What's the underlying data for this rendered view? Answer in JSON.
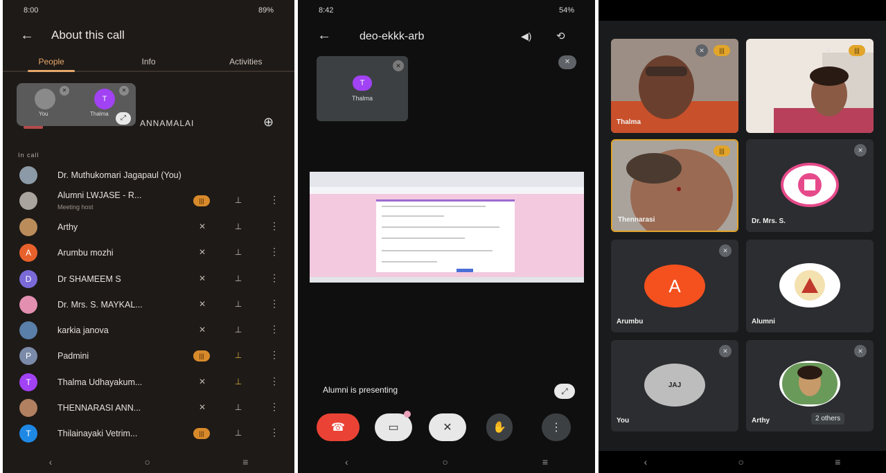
{
  "phone1": {
    "status_left": "8:00",
    "status_right": "89%",
    "title": "About this call",
    "tabs": [
      "People",
      "Info",
      "Activities"
    ],
    "pip": {
      "tile1_label": "You",
      "tile2_initial": "T",
      "tile2_label": "Thalma"
    },
    "pinned_name_suffix": "ANNAMALAI",
    "section_label": "In call",
    "participants": [
      {
        "name": "Dr. Muthukomari Jagapaul (You)",
        "initial": "",
        "color": "#8b9aa6",
        "sub": "",
        "mic": "",
        "pin": "",
        "more": ""
      },
      {
        "name": "Alumni LWJASE - R...",
        "initial": "",
        "color": "#a9a49e",
        "sub": "Meeting host",
        "mic": "talk",
        "pin": "pin",
        "more": "more"
      },
      {
        "name": "Arthy",
        "initial": "",
        "color": "#b98c5a",
        "sub": "",
        "mic": "muted",
        "pin": "pin",
        "more": "more"
      },
      {
        "name": "Arumbu mozhi",
        "initial": "A",
        "color": "#e8612c",
        "sub": "",
        "mic": "muted",
        "pin": "pin",
        "more": "more"
      },
      {
        "name": "Dr SHAMEEM S",
        "initial": "D",
        "color": "#7a6ad8",
        "sub": "",
        "mic": "muted",
        "pin": "pin",
        "more": "more"
      },
      {
        "name": "Dr. Mrs. S. MAYKAL...",
        "initial": "",
        "color": "#e28fb0",
        "sub": "",
        "mic": "muted",
        "pin": "pin",
        "more": "more"
      },
      {
        "name": "karkia janova",
        "initial": "",
        "color": "#5a7fa8",
        "sub": "",
        "mic": "muted",
        "pin": "pin",
        "more": "more"
      },
      {
        "name": "Padmini",
        "initial": "P",
        "color": "#7a8aa8",
        "sub": "",
        "mic": "talk",
        "pin": "pin-gold",
        "more": "more"
      },
      {
        "name": "Thalma Udhayakum...",
        "initial": "T",
        "color": "#a142f4",
        "sub": "",
        "mic": "muted",
        "pin": "pin-gold",
        "more": "more"
      },
      {
        "name": "THENNARASI ANN...",
        "initial": "",
        "color": "#b08060",
        "sub": "",
        "mic": "muted",
        "pin": "pin",
        "more": "more"
      },
      {
        "name": "Thilainayaki Vetrim...",
        "initial": "T",
        "color": "#1e88e5",
        "sub": "",
        "mic": "talk",
        "pin": "pin",
        "more": "more"
      }
    ]
  },
  "phone2": {
    "status_left": "8:42",
    "status_right": "54%",
    "meeting_code": "deo-ekkk-arb",
    "self_tile": {
      "initial": "T",
      "name": "Thalma"
    },
    "presenting_text": "Alumni is presenting",
    "controls": [
      "end-call",
      "camera-off",
      "mic-off",
      "raise-hand",
      "more"
    ]
  },
  "phone3": {
    "tiles": [
      {
        "name": "Thalma",
        "kind": "photo",
        "color": "#8a5a40"
      },
      {
        "name": "",
        "kind": "photo",
        "color": "#a07a66"
      },
      {
        "name": "Thennarasi",
        "kind": "photo",
        "color": "#9a6a52"
      },
      {
        "name": "Dr. Mrs. S.",
        "kind": "logo",
        "color": "#e64a8a"
      },
      {
        "name": "Arumbu",
        "kind": "initial",
        "initial": "A",
        "color": "#f4511e"
      },
      {
        "name": "Alumni",
        "kind": "logo",
        "color": "#c0392b"
      },
      {
        "name": "You",
        "kind": "initial",
        "initial": "JAJ",
        "color": "#bdbdbd"
      },
      {
        "name": "Arthy",
        "kind": "photo-round",
        "color": "#c79a6a"
      }
    ],
    "others_label": "2 others"
  }
}
